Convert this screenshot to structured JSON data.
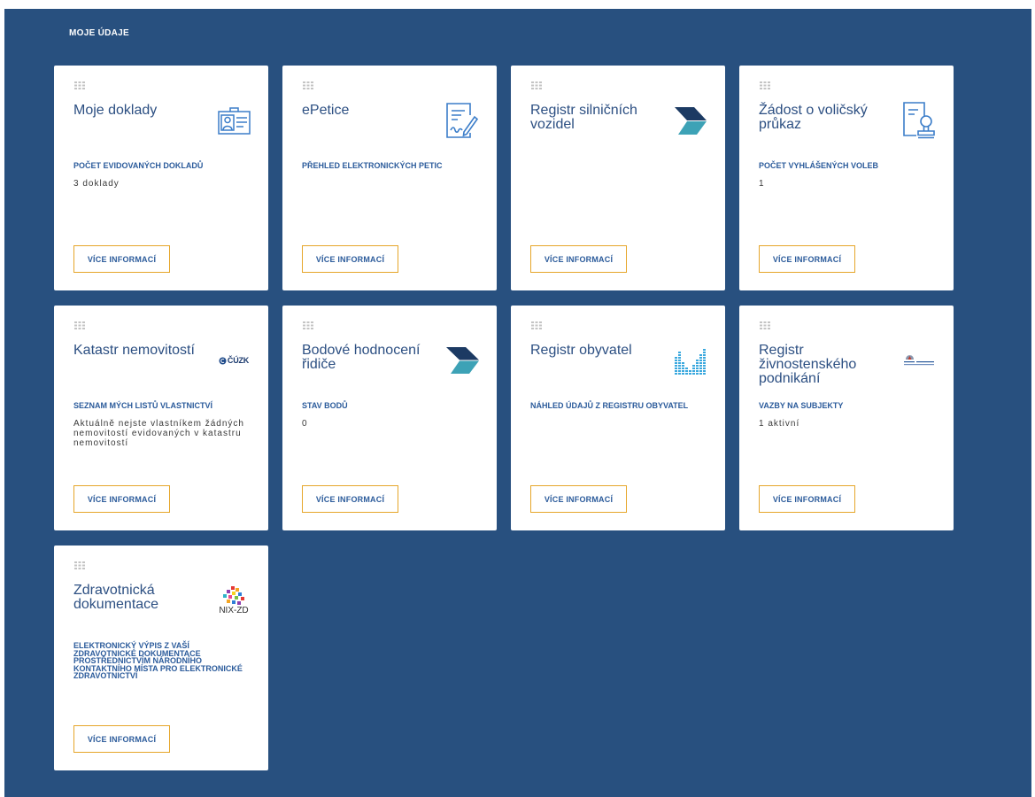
{
  "section_title": "MOJE ÚDAJE",
  "theme": {
    "panel": "#28507f",
    "card": "#ffffff",
    "title": "#2c4f82",
    "label": "#2b5b9b",
    "value": "#3a3a3a",
    "button_border": "#e6a62a"
  },
  "cards": [
    {
      "title": "Moje doklady",
      "icon": "id-card-icon",
      "label": "POČET EVIDOVANÝCH DOKLADŮ",
      "value": "3 doklady",
      "button": "VÍCE INFORMACÍ"
    },
    {
      "title": "ePetice",
      "icon": "document-signature-icon",
      "label": "PŘEHLED ELEKTRONICKÝCH PETIC",
      "button": "VÍCE INFORMACÍ"
    },
    {
      "title": "Registr silničních vozidel",
      "icon": "vehicle-registry-logo-icon",
      "button": "VÍCE INFORMACÍ"
    },
    {
      "title": "Žádost o voličský průkaz",
      "icon": "document-stamp-icon",
      "label": "POČET VYHLÁŠENÝCH VOLEB",
      "value": "1",
      "button": "VÍCE INFORMACÍ"
    },
    {
      "title": "Katastr nemovitostí",
      "icon": "cuzk-logo-icon",
      "logo_text": "ČÚZK",
      "label": "SEZNAM MÝCH LISTŮ VLASTNICTVÍ",
      "value": "Aktuálně nejste vlastníkem žádných nemovitostí evidovaných v katastru nemovitostí",
      "button": "VÍCE INFORMACÍ"
    },
    {
      "title": "Bodové hodnocení řidiče",
      "icon": "driver-points-logo-icon",
      "label": "STAV BODŮ",
      "value": "0",
      "button": "VÍCE INFORMACÍ"
    },
    {
      "title": "Registr obyvatel",
      "icon": "population-registry-logo-icon",
      "label": "NÁHLED ÚDAJŮ Z REGISTRU OBYVATEL",
      "button": "VÍCE INFORMACÍ"
    },
    {
      "title": "Registr živnostenského podnikání",
      "icon": "trade-registry-logo-icon",
      "label": "VAZBY NA SUBJEKTY",
      "value": "1 aktivní",
      "button": "VÍCE INFORMACÍ"
    },
    {
      "title": "Zdravotnická dokumentace",
      "icon": "nix-zd-logo-icon",
      "logo_text": "NIX-ZD",
      "label": "ELEKTRONICKÝ VÝPIS Z VAŠÍ ZDRAVOTNICKÉ DOKUMENTACE PROSTŘEDNICTVÍM NÁRODNÍHO KONTAKTNÍHO MÍSTA PRO ELEKTRONICKÉ ZDRAVOTNICTVÍ",
      "button": "VÍCE INFORMACÍ"
    }
  ]
}
